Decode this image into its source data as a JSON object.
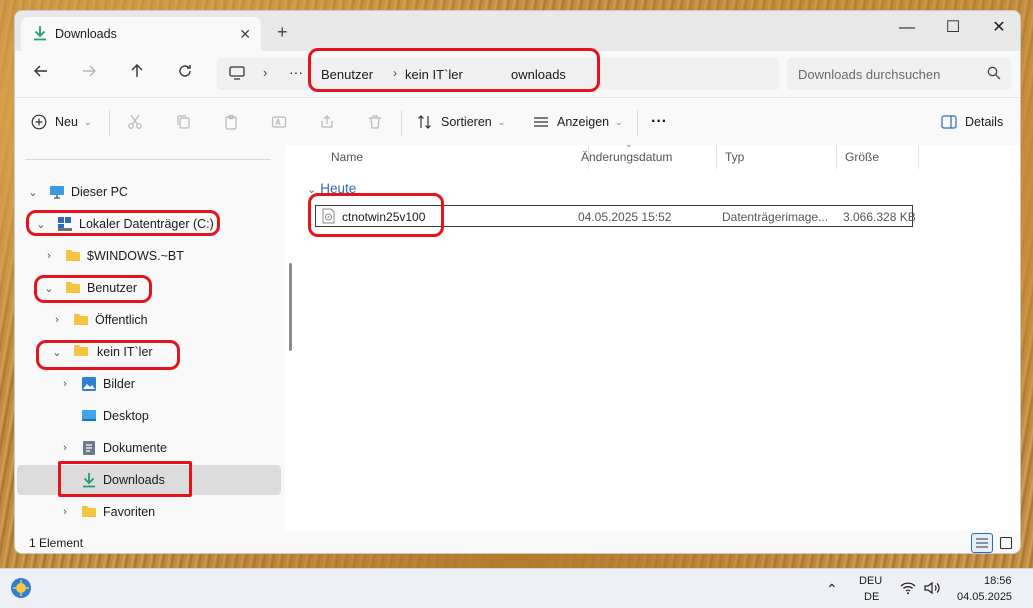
{
  "window": {
    "tab_title": "Downloads",
    "new_tab": "+",
    "minimize": "—",
    "maximize": "☐",
    "close": "✕"
  },
  "address": {
    "more": "···",
    "segments": [
      "Benutzer",
      "kein IT`ler",
      "ownloads"
    ],
    "search_placeholder": "Downloads durchsuchen"
  },
  "toolbar": {
    "new_label": "Neu",
    "sort_label": "Sortieren",
    "view_label": "Anzeigen",
    "more_label": "···",
    "details_label": "Details"
  },
  "sidebar": {
    "items": [
      {
        "label": "Dieser PC",
        "icon": "monitor-icon"
      },
      {
        "label": "Lokaler Datenträger (C:)",
        "icon": "drive-icon"
      },
      {
        "label": "$WINDOWS.~BT",
        "icon": "folder-icon"
      },
      {
        "label": "Benutzer",
        "icon": "folder-icon"
      },
      {
        "label": "Öffentlich",
        "icon": "folder-icon"
      },
      {
        "label": "kein IT`ler",
        "icon": "folder-icon"
      },
      {
        "label": "Bilder",
        "icon": "pictures-icon"
      },
      {
        "label": "Desktop",
        "icon": "desktop-icon"
      },
      {
        "label": "Dokumente",
        "icon": "documents-icon"
      },
      {
        "label": "Downloads",
        "icon": "download-icon"
      },
      {
        "label": "Favoriten",
        "icon": "folder-icon"
      }
    ]
  },
  "files": {
    "columns": [
      "Name",
      "Änderungsdatum",
      "Typ",
      "Größe"
    ],
    "group": "Heute",
    "rows": [
      {
        "name": "ctnotwin25v100",
        "date": "04.05.2025 15:52",
        "type": "Datenträgerimage...",
        "size": "3.066.328 KB"
      }
    ]
  },
  "status": {
    "count": "1 Element"
  },
  "taskbar": {
    "lang1": "DEU",
    "lang2": "DE",
    "time": "18:56",
    "date": "04.05.2025"
  },
  "colors": {
    "accent": "#2d6ab8",
    "annotation": "#e3141b",
    "download_green": "#1f9d6b",
    "folder": "#f4c542"
  }
}
